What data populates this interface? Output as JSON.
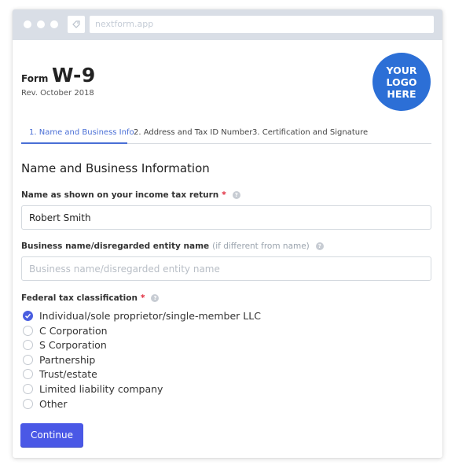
{
  "browser": {
    "url": "nextform.app",
    "icon": "tag-icon"
  },
  "header": {
    "form_prefix": "Form",
    "form_name": "W-9",
    "revision": "Rev. October 2018",
    "logo_lines": [
      "YOUR",
      "LOGO",
      "HERE"
    ],
    "logo_color": "#2c6fd6"
  },
  "tabs": [
    {
      "label": "1. Name and Business Info",
      "active": true
    },
    {
      "label": "2. Address and Tax ID Number",
      "active": false
    },
    {
      "label": "3. Certification and Signature",
      "active": false
    }
  ],
  "section": {
    "title": "Name and Business Information"
  },
  "fields": {
    "name": {
      "label": "Name as shown on your income tax return",
      "required_mark": "*",
      "value": "Robert Smith",
      "placeholder": ""
    },
    "business": {
      "label": "Business name/disregarded entity name",
      "hint": "(if different from name)",
      "value": "",
      "placeholder": "Business name/disregarded entity name"
    },
    "classification": {
      "label": "Federal tax classification",
      "required_mark": "*",
      "options": [
        {
          "label": "Individual/sole proprietor/single-member LLC",
          "checked": true
        },
        {
          "label": "C Corporation",
          "checked": false
        },
        {
          "label": "S Corporation",
          "checked": false
        },
        {
          "label": "Partnership",
          "checked": false
        },
        {
          "label": "Trust/estate",
          "checked": false
        },
        {
          "label": "Limited liability company",
          "checked": false
        },
        {
          "label": "Other",
          "checked": false
        }
      ]
    }
  },
  "help_glyph": "?",
  "actions": {
    "continue_label": "Continue"
  },
  "colors": {
    "accent": "#4a58e6",
    "tab_active": "#4a6fd6",
    "required": "#e0283a",
    "titlebar": "#d9dee6"
  }
}
